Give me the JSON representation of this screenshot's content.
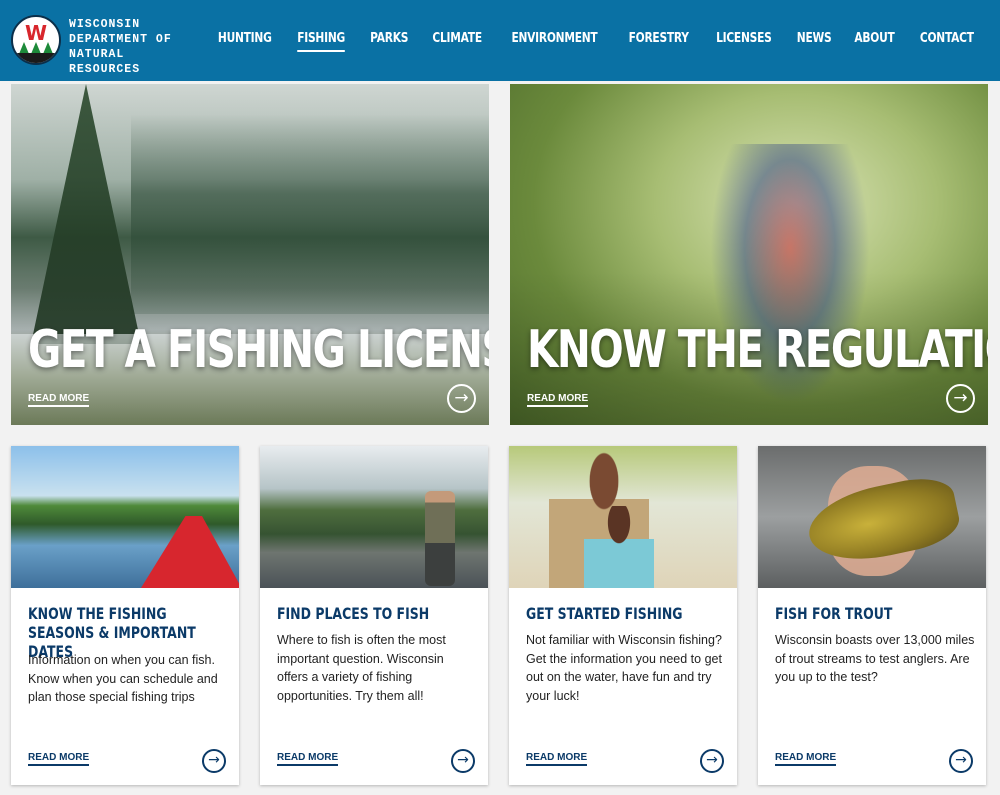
{
  "brand": {
    "logo_letter": "W",
    "name_lines": [
      "WISCONSIN",
      "DEPARTMENT OF",
      "NATURAL RESOURCES"
    ]
  },
  "nav": {
    "items": [
      {
        "label": "HUNTING",
        "active": false
      },
      {
        "label": "FISHING",
        "active": true
      },
      {
        "label": "PARKS",
        "active": false
      },
      {
        "label": "CLIMATE",
        "active": false
      },
      {
        "label": "ENVIRONMENT",
        "active": false
      },
      {
        "label": "FORESTRY",
        "active": false
      },
      {
        "label": "LICENSES",
        "active": false
      },
      {
        "label": "NEWS",
        "active": false
      },
      {
        "label": "ABOUT",
        "active": false
      },
      {
        "label": "CONTACT",
        "active": false
      }
    ]
  },
  "hero": [
    {
      "title": "GET A FISHING LICENSE",
      "read_more": "READ MORE",
      "image": "misty-lake-campsite-photo"
    },
    {
      "title": "KNOW THE REGULATIONS",
      "read_more": "READ MORE",
      "image": "family-fishing-river-photo"
    }
  ],
  "cards": [
    {
      "title": "KNOW THE FISHING SEASONS & IMPORTANT DATES",
      "body": "Information on when you can fish. Know when you can schedule and plan those special fishing trips",
      "read_more": "READ MORE",
      "image": "red-kayak-lake-photo"
    },
    {
      "title": "FIND PLACES TO FISH",
      "body": "Where to fish is often the most important question. Wisconsin offers a variety of fishing opportunities. Try them all!",
      "read_more": "READ MORE",
      "image": "fly-fisherman-river-photo"
    },
    {
      "title": "GET STARTED FISHING",
      "body": "Not familiar with Wisconsin fishing? Get the information you need to get out on the water, have fun and try your luck!",
      "read_more": "READ MORE",
      "image": "father-daughter-fish-photo"
    },
    {
      "title": "FISH FOR TROUT",
      "body": "Wisconsin boasts over 13,000 miles of trout streams to test anglers. Are you up to the test?",
      "read_more": "READ MORE",
      "image": "brown-trout-hands-photo"
    }
  ],
  "icons": {
    "arrow": "arrow-right-circle-icon"
  },
  "colors": {
    "header_bg": "#0a71a4",
    "title_navy": "#0b3a68",
    "logo_red": "#d8262c"
  }
}
